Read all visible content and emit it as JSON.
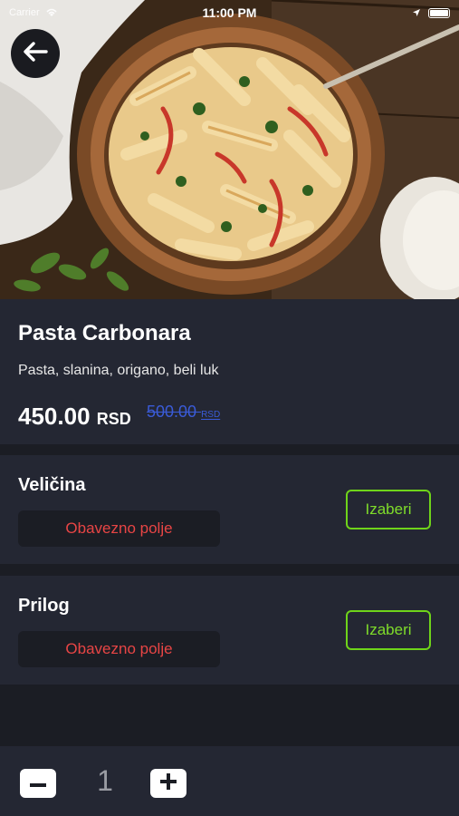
{
  "status_bar": {
    "carrier": "Carrier",
    "time": "11:00 PM"
  },
  "icons": {
    "back": "arrow-left-icon",
    "wifi": "wifi-icon",
    "location": "location-arrow-icon",
    "battery": "battery-icon",
    "minus": "minus-icon",
    "plus": "plus-icon"
  },
  "product": {
    "name": "Pasta Carbonara",
    "description": "Pasta, slanina, origano, beli luk",
    "price": "450.00",
    "price_currency": "RSD",
    "old_price": "500.00",
    "old_price_currency": "RSD"
  },
  "options": [
    {
      "title": "Veličina",
      "required_text": "Obavezno polje",
      "button_label": "Izaberi"
    },
    {
      "title": "Prilog",
      "required_text": "Obavezno polje",
      "button_label": "Izaberi"
    }
  ],
  "quantity": {
    "value": "1"
  },
  "colors": {
    "accent_green": "#6fd41a",
    "required_red": "#e84545",
    "old_price_blue": "#3a5bd8",
    "card_bg": "#242733",
    "page_bg": "#1b1d24"
  }
}
